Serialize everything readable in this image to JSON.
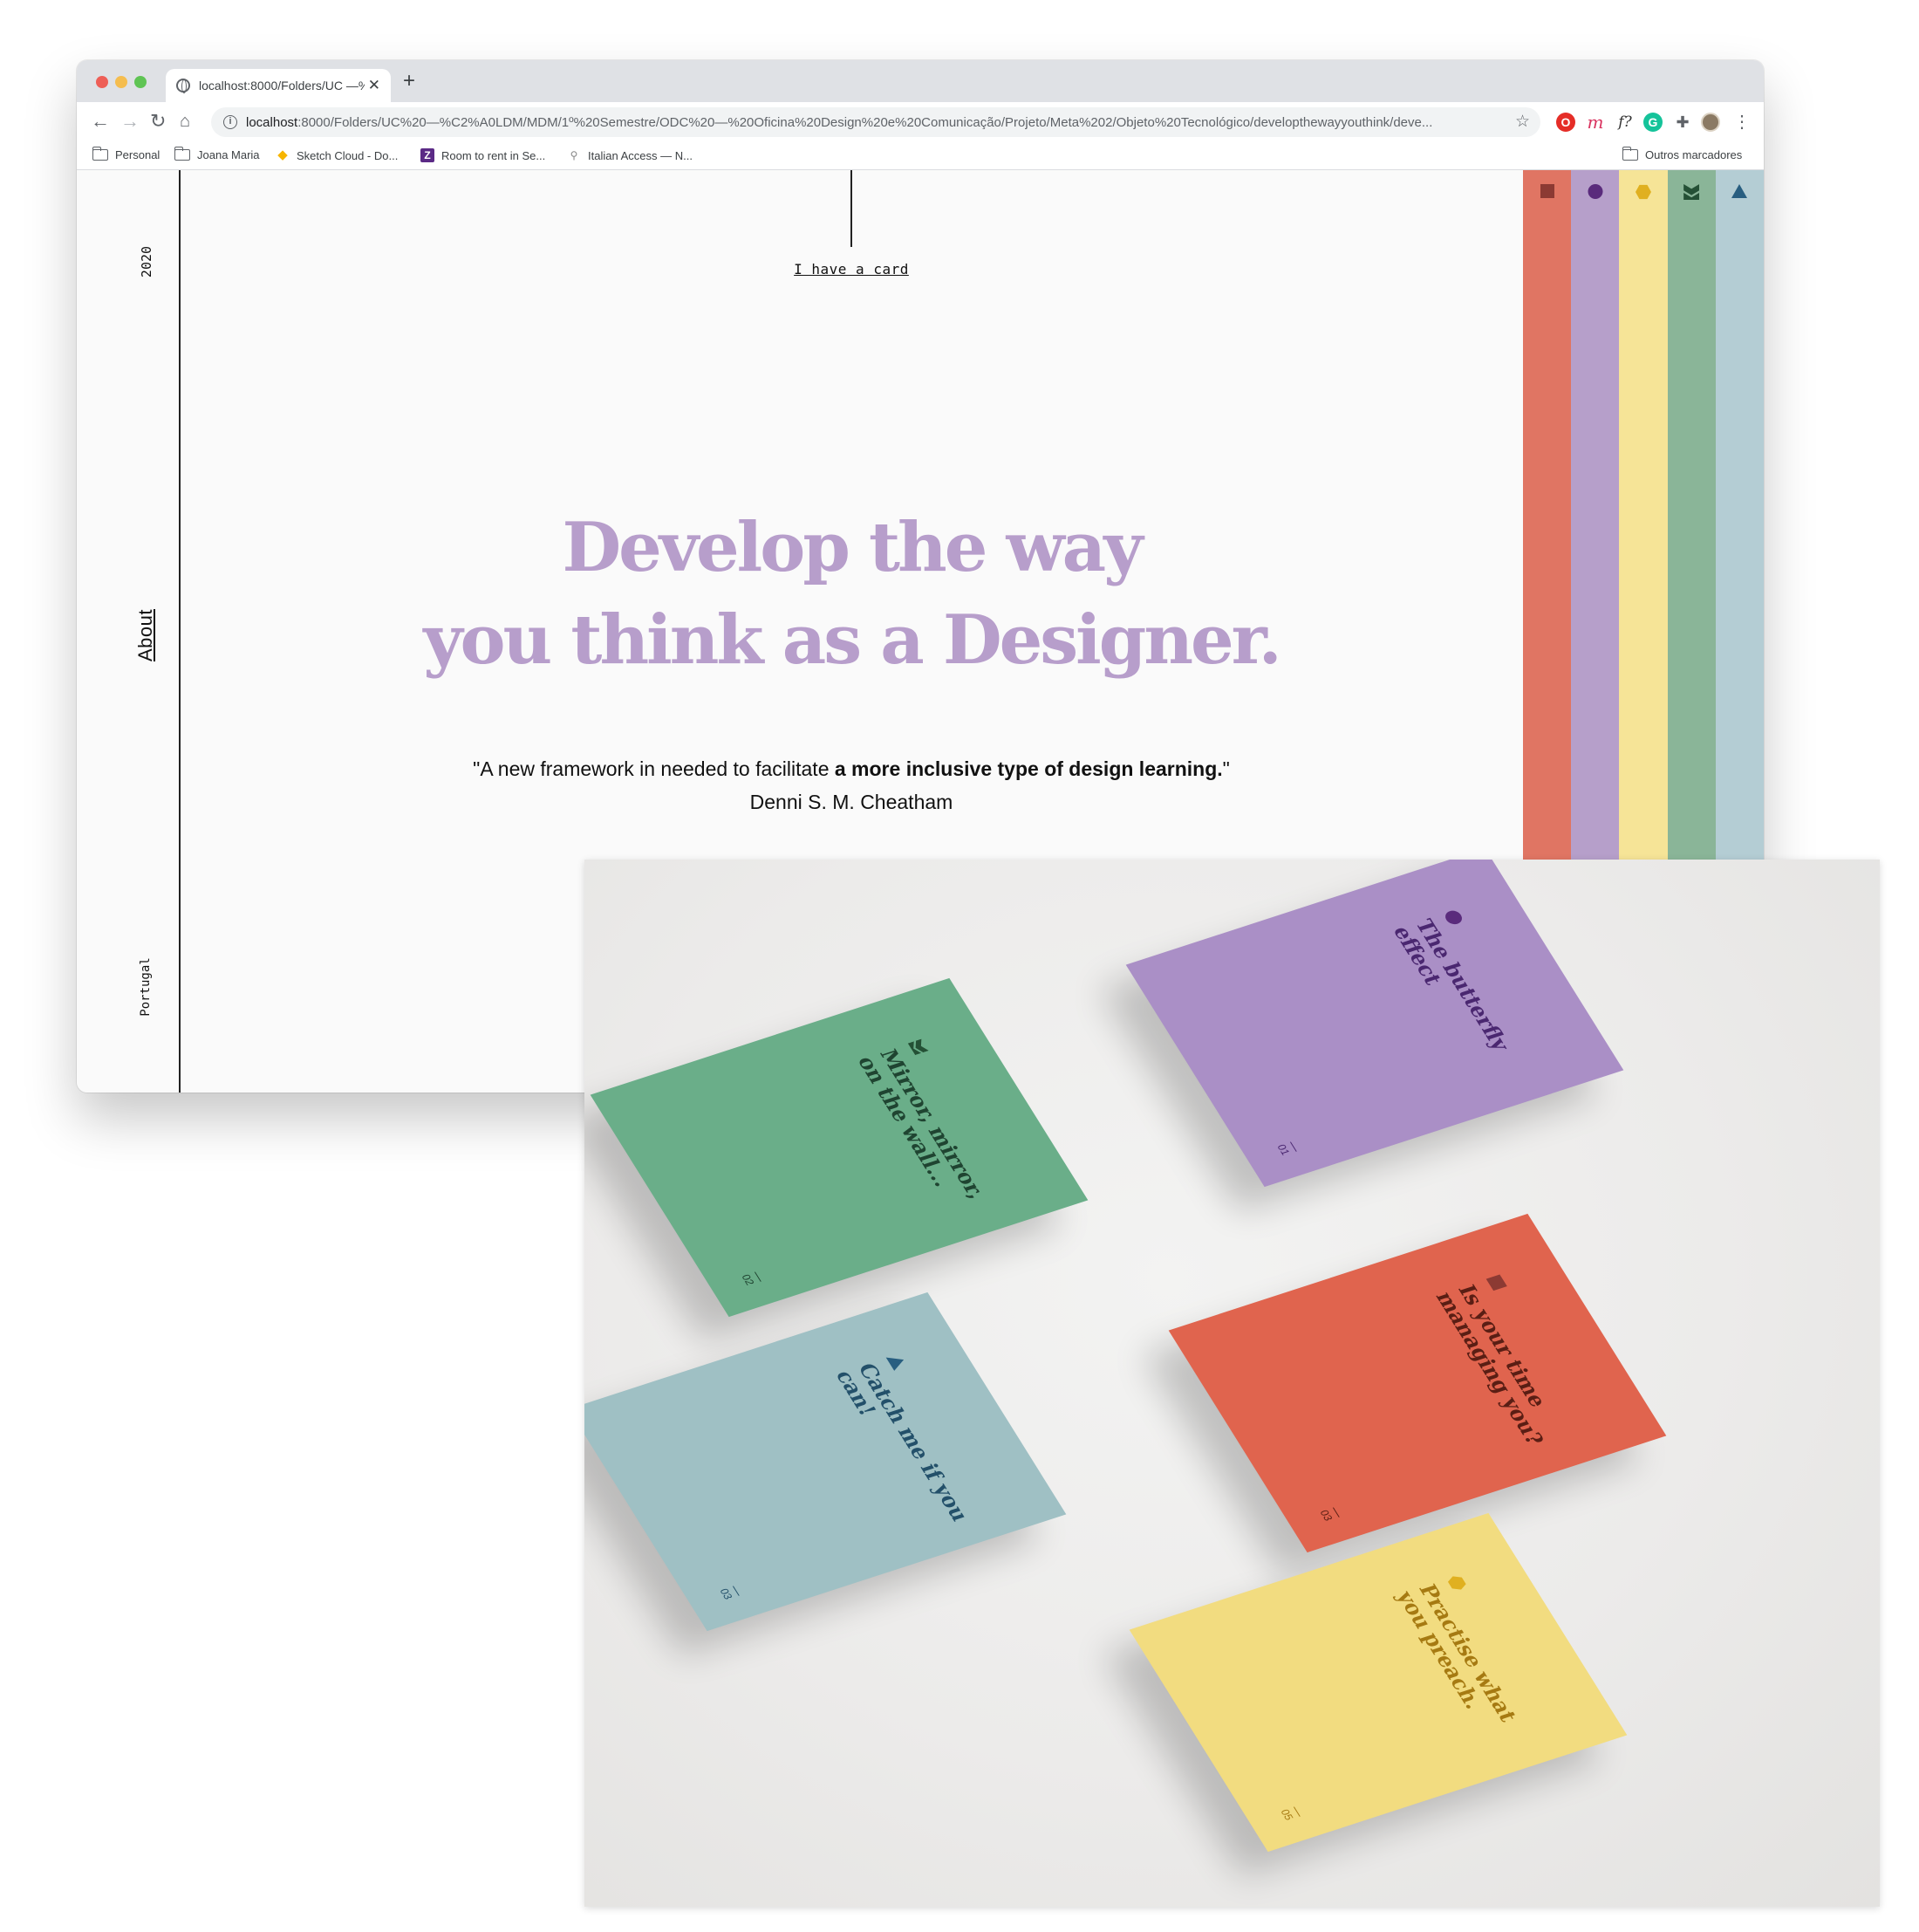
{
  "browser": {
    "tab": {
      "title": "localhost:8000/Folders/UC —%"
    },
    "url": {
      "host": "localhost",
      "path": ":8000/Folders/UC%20—%C2%A0LDM/MDM/1º%20Semestre/ODC%20—%20Oficina%20Design%20e%20Comunicação/Projeto/Meta%202/Objeto%20Tecnológico/developthewayyouthink/deve..."
    },
    "extensions": {
      "ext_1": "O",
      "ext_2": "m",
      "ext_3": "f?",
      "ext_4": "G"
    },
    "bookmarks": [
      {
        "label": "Personal",
        "icon": "folder-icon"
      },
      {
        "label": "Joana Maria",
        "icon": "folder-icon"
      },
      {
        "label": "Sketch Cloud - Do...",
        "icon": "sketch-icon"
      },
      {
        "label": "Room to rent in Se...",
        "icon": "z-icon"
      },
      {
        "label": "Italian Access — N...",
        "icon": "pin-icon"
      }
    ],
    "other_bookmarks": "Outros marcadores"
  },
  "page": {
    "sidebar": {
      "year": "2020",
      "about": "About",
      "country": "Portugal"
    },
    "have_card": "I have a card",
    "headline": {
      "line1": "Develop the way",
      "line2": "you think as a Designer."
    },
    "quote": {
      "pre": "\"A new framework in needed to facilitate ",
      "bold": "a more inclusive type of design learning.",
      "post": "\"",
      "author": "Denni S. M. Cheatham"
    },
    "stripes": [
      {
        "color": "#e07563",
        "icon": "square-icon"
      },
      {
        "color": "#b69fca",
        "icon": "circle-icon"
      },
      {
        "color": "#f6e497",
        "icon": "hexagon-icon"
      },
      {
        "color": "#8ab598",
        "icon": "bowtie-icon"
      },
      {
        "color": "#b4cdd4",
        "icon": "triangle-icon"
      }
    ]
  },
  "cards": [
    {
      "title": "Mirror, mirror, on the wall...",
      "number": "02",
      "color": "#6aae89"
    },
    {
      "title": "The butterfly effect",
      "number": "01",
      "color": "#aa8fc6"
    },
    {
      "title": "Is your time managing you?",
      "number": "03",
      "color": "#e0644e"
    },
    {
      "title": "Catch me if you can!",
      "number": "03",
      "color": "#9fc0c4"
    },
    {
      "title": "Practise what you preach.",
      "number": "05",
      "color": "#f2dc80"
    }
  ]
}
